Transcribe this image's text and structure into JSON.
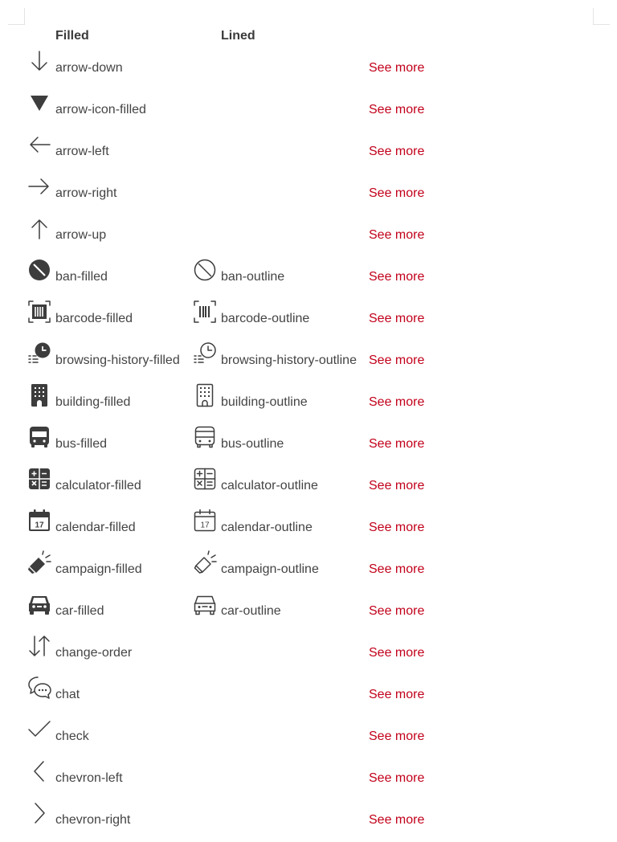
{
  "header": {
    "filled": "Filled",
    "lined": "Lined"
  },
  "see_more_label": "See more",
  "accent_color": "#c2001a",
  "rows": [
    {
      "filled": {
        "name": "arrow-down",
        "icon": "arrow-down-icon"
      }
    },
    {
      "filled": {
        "name": "arrow-icon-filled",
        "icon": "arrow-icon-filled-icon"
      }
    },
    {
      "filled": {
        "name": "arrow-left",
        "icon": "arrow-left-icon"
      }
    },
    {
      "filled": {
        "name": "arrow-right",
        "icon": "arrow-right-icon"
      }
    },
    {
      "filled": {
        "name": "arrow-up",
        "icon": "arrow-up-icon"
      }
    },
    {
      "filled": {
        "name": "ban-filled",
        "icon": "ban-filled-icon"
      },
      "lined": {
        "name": "ban-outline",
        "icon": "ban-outline-icon"
      }
    },
    {
      "filled": {
        "name": "barcode-filled",
        "icon": "barcode-filled-icon"
      },
      "lined": {
        "name": "barcode-outline",
        "icon": "barcode-outline-icon"
      }
    },
    {
      "filled": {
        "name": "browsing-history-filled",
        "icon": "browsing-history-filled-icon"
      },
      "lined": {
        "name": "browsing-history-outline",
        "icon": "browsing-history-outline-icon"
      }
    },
    {
      "filled": {
        "name": "building-filled",
        "icon": "building-filled-icon"
      },
      "lined": {
        "name": "building-outline",
        "icon": "building-outline-icon"
      }
    },
    {
      "filled": {
        "name": "bus-filled",
        "icon": "bus-filled-icon"
      },
      "lined": {
        "name": "bus-outline",
        "icon": "bus-outline-icon"
      }
    },
    {
      "filled": {
        "name": "calculator-filled",
        "icon": "calculator-filled-icon"
      },
      "lined": {
        "name": "calculator-outline",
        "icon": "calculator-outline-icon"
      }
    },
    {
      "filled": {
        "name": "calendar-filled",
        "icon": "calendar-filled-icon"
      },
      "lined": {
        "name": "calendar-outline",
        "icon": "calendar-outline-icon"
      }
    },
    {
      "filled": {
        "name": "campaign-filled",
        "icon": "campaign-filled-icon"
      },
      "lined": {
        "name": "campaign-outline",
        "icon": "campaign-outline-icon"
      }
    },
    {
      "filled": {
        "name": "car-filled",
        "icon": "car-filled-icon"
      },
      "lined": {
        "name": "car-outline",
        "icon": "car-outline-icon"
      }
    },
    {
      "filled": {
        "name": "change-order",
        "icon": "change-order-icon"
      }
    },
    {
      "filled": {
        "name": "chat",
        "icon": "chat-icon"
      }
    },
    {
      "filled": {
        "name": "check",
        "icon": "check-icon"
      }
    },
    {
      "filled": {
        "name": "chevron-left",
        "icon": "chevron-left-icon"
      }
    },
    {
      "filled": {
        "name": "chevron-right",
        "icon": "chevron-right-icon"
      }
    }
  ]
}
